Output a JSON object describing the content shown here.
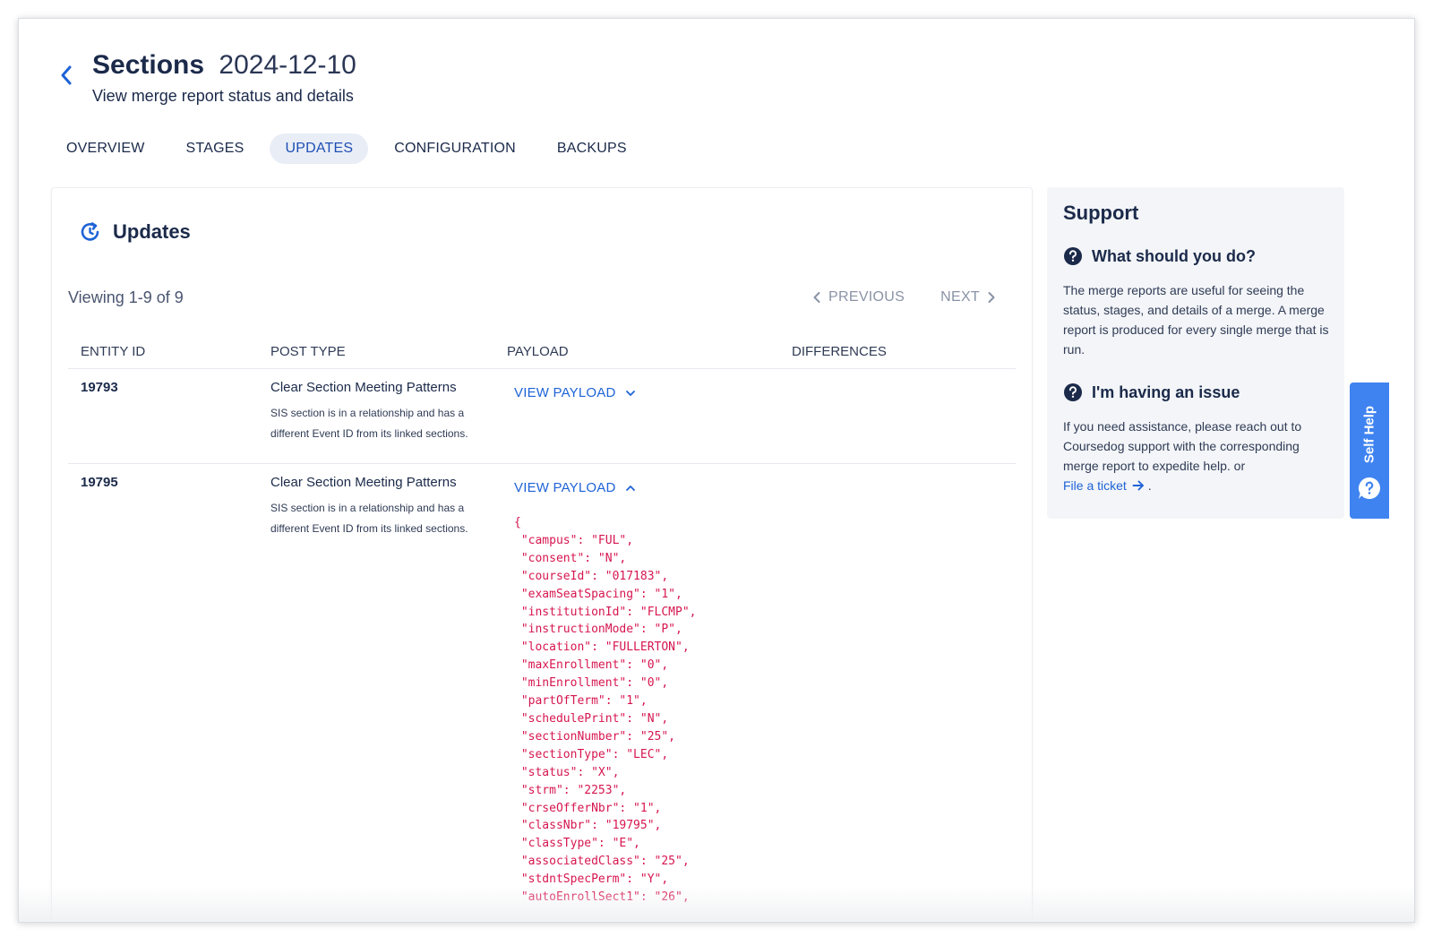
{
  "header": {
    "title": "Sections",
    "date": "2024-12-10",
    "subtitle": "View merge report status and details"
  },
  "tabs": [
    {
      "label": "OVERVIEW",
      "active": false
    },
    {
      "label": "STAGES",
      "active": false
    },
    {
      "label": "UPDATES",
      "active": true
    },
    {
      "label": "CONFIGURATION",
      "active": false
    },
    {
      "label": "BACKUPS",
      "active": false
    }
  ],
  "updates": {
    "title": "Updates",
    "viewing": "Viewing 1-9 of 9",
    "previous": "PREVIOUS",
    "next": "NEXT",
    "columns": [
      "ENTITY ID",
      "POST TYPE",
      "PAYLOAD",
      "DIFFERENCES"
    ],
    "rows": [
      {
        "entity_id": "19793",
        "post_type": "Clear Section Meeting Patterns",
        "description": "SIS section is in a relationship and has a different Event ID from its linked sections.",
        "view_payload": "VIEW PAYLOAD",
        "expanded": false
      },
      {
        "entity_id": "19795",
        "post_type": "Clear Section Meeting Patterns",
        "description": "SIS section is in a relationship and has a different Event ID from its linked sections.",
        "view_payload": "VIEW PAYLOAD",
        "expanded": true,
        "payload": "{\n \"campus\": \"FUL\",\n \"consent\": \"N\",\n \"courseId\": \"017183\",\n \"examSeatSpacing\": \"1\",\n \"institutionId\": \"FLCMP\",\n \"instructionMode\": \"P\",\n \"location\": \"FULLERTON\",\n \"maxEnrollment\": \"0\",\n \"minEnrollment\": \"0\",\n \"partOfTerm\": \"1\",\n \"schedulePrint\": \"N\",\n \"sectionNumber\": \"25\",\n \"sectionType\": \"LEC\",\n \"status\": \"X\",\n \"strm\": \"2253\",\n \"crseOfferNbr\": \"1\",\n \"classNbr\": \"19795\",\n \"classType\": \"E\",\n \"associatedClass\": \"25\",\n \"stdntSpecPerm\": \"Y\",\n \"autoEnrollSect1\": \"26\","
      }
    ]
  },
  "support": {
    "title": "Support",
    "q1_title": "What should you do?",
    "q1_text": "The merge reports are useful for seeing the status, stages, and details of a merge. A merge report is produced for every single merge that is run.",
    "q2_title": "I'm having an issue",
    "q2_text": "If you need assistance, please reach out to Coursedog support with the corresponding merge report to expedite help. or",
    "link_label": "File a ticket",
    "link_suffix": "."
  },
  "self_help": {
    "label": "Self Help"
  },
  "colors": {
    "accent": "#1e63d6",
    "navy": "#1b2a4a",
    "payload": "#d6164f",
    "self_help_bg": "#3f83f0"
  },
  "icons": [
    "chevron-left-icon",
    "refresh-clock-icon",
    "chevron-down-icon",
    "chevron-up-icon",
    "chevron-right-icon",
    "question-circle-icon",
    "arrow-right-icon",
    "chat-question-icon"
  ]
}
